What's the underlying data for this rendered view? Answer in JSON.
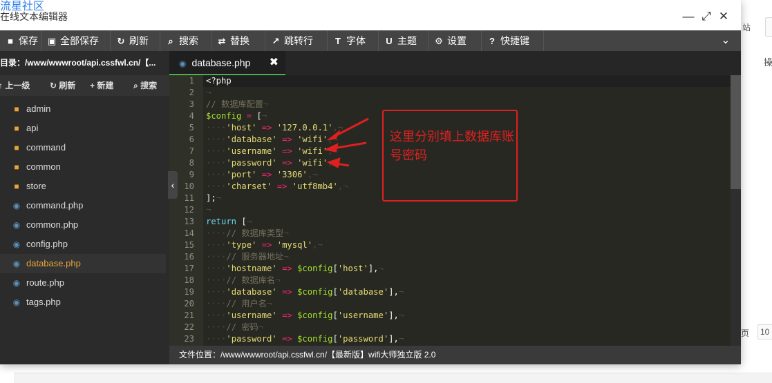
{
  "background": {
    "right_top_text": "站",
    "right_side_text": "操",
    "pager_text": "页",
    "pager_value": "10"
  },
  "window": {
    "brand": "流星社区",
    "title": "在线文本编辑器",
    "minimize_glyph": "—",
    "maximize_glyph": "⤢",
    "close_glyph": "✕"
  },
  "toolbar": {
    "items": [
      {
        "label": "保存",
        "icon": "save-icon"
      },
      {
        "label": "全部保存",
        "icon": "save-all-icon"
      },
      {
        "label": "刷新",
        "icon": "refresh-icon"
      },
      {
        "label": "搜索",
        "icon": "search-icon"
      },
      {
        "label": "替换",
        "icon": "replace-icon"
      },
      {
        "label": "跳转行",
        "icon": "goto-icon"
      },
      {
        "label": "字体",
        "icon": "font-icon"
      },
      {
        "label": "主题",
        "icon": "theme-icon"
      },
      {
        "label": "设置",
        "icon": "gear-icon"
      },
      {
        "label": "快捷键",
        "icon": "help-icon"
      }
    ]
  },
  "sidebar": {
    "path": "目录：/www/wwwroot/api.cssfwl.cn/【...",
    "actions": [
      {
        "label": "上一级",
        "icon": "up-icon"
      },
      {
        "label": "刷新",
        "icon": "refresh-icon"
      },
      {
        "label": "新建",
        "icon": "plus-icon"
      },
      {
        "label": "搜索",
        "icon": "search-icon"
      }
    ],
    "files": [
      {
        "name": "admin",
        "type": "folder"
      },
      {
        "name": "api",
        "type": "folder"
      },
      {
        "name": "command",
        "type": "folder"
      },
      {
        "name": "common",
        "type": "folder"
      },
      {
        "name": "store",
        "type": "folder"
      },
      {
        "name": "command.php",
        "type": "php"
      },
      {
        "name": "common.php",
        "type": "php"
      },
      {
        "name": "config.php",
        "type": "php"
      },
      {
        "name": "database.php",
        "type": "php",
        "active": true
      },
      {
        "name": "route.php",
        "type": "php"
      },
      {
        "name": "tags.php",
        "type": "php"
      }
    ]
  },
  "tab": {
    "label": "database.php",
    "close": "✖"
  },
  "code": {
    "lines": [
      [
        [
          "<?php",
          "pl"
        ]
      ],
      [
        [
          "¬",
          "ws"
        ]
      ],
      [
        [
          "// 数据库配置",
          "cm"
        ],
        [
          "¬",
          "ws"
        ]
      ],
      [
        [
          "$config",
          "vr"
        ],
        [
          " = ",
          "op"
        ],
        [
          "[",
          "pl"
        ],
        [
          "¬",
          "ws"
        ]
      ],
      [
        [
          "····",
          "ws"
        ],
        [
          "'host'",
          "st"
        ],
        [
          " => ",
          "op"
        ],
        [
          "'127.0.0.1'",
          "st"
        ],
        [
          ",¬",
          "ws"
        ]
      ],
      [
        [
          "····",
          "ws"
        ],
        [
          "'database'",
          "st"
        ],
        [
          " => ",
          "op"
        ],
        [
          "'wifi'",
          "st"
        ],
        [
          ",¬",
          "ws"
        ]
      ],
      [
        [
          "····",
          "ws"
        ],
        [
          "'username'",
          "st"
        ],
        [
          " => ",
          "op"
        ],
        [
          "'wifi'",
          "st"
        ],
        [
          ",¬",
          "ws"
        ]
      ],
      [
        [
          "····",
          "ws"
        ],
        [
          "'password'",
          "st"
        ],
        [
          " => ",
          "op"
        ],
        [
          "'wifi'",
          "st"
        ],
        [
          ",¬",
          "ws"
        ]
      ],
      [
        [
          "····",
          "ws"
        ],
        [
          "'port'",
          "st"
        ],
        [
          " => ",
          "op"
        ],
        [
          "'3306'",
          "st"
        ],
        [
          ",¬",
          "ws"
        ]
      ],
      [
        [
          "····",
          "ws"
        ],
        [
          "'charset'",
          "st"
        ],
        [
          " => ",
          "op"
        ],
        [
          "'utf8mb4'",
          "st"
        ],
        [
          ",¬",
          "ws"
        ]
      ],
      [
        [
          "];",
          "pl"
        ],
        [
          "¬",
          "ws"
        ]
      ],
      [
        [
          "¬",
          "ws"
        ]
      ],
      [
        [
          "return",
          "kw"
        ],
        [
          " [",
          "pl"
        ],
        [
          "¬",
          "ws"
        ]
      ],
      [
        [
          "····",
          "ws"
        ],
        [
          "// 数据库类型",
          "cm"
        ],
        [
          "¬",
          "ws"
        ]
      ],
      [
        [
          "····",
          "ws"
        ],
        [
          "'type'",
          "st"
        ],
        [
          " => ",
          "op"
        ],
        [
          "'mysql'",
          "st"
        ],
        [
          ",¬",
          "ws"
        ]
      ],
      [
        [
          "····",
          "ws"
        ],
        [
          "// 服务器地址",
          "cm"
        ],
        [
          "¬",
          "ws"
        ]
      ],
      [
        [
          "····",
          "ws"
        ],
        [
          "'hostname'",
          "st"
        ],
        [
          " => ",
          "op"
        ],
        [
          "$config",
          "vr"
        ],
        [
          "[",
          "pl"
        ],
        [
          "'host'",
          "st"
        ],
        [
          "],",
          "pl"
        ],
        [
          "¬",
          "ws"
        ]
      ],
      [
        [
          "····",
          "ws"
        ],
        [
          "// 数据库名",
          "cm"
        ],
        [
          "¬",
          "ws"
        ]
      ],
      [
        [
          "····",
          "ws"
        ],
        [
          "'database'",
          "st"
        ],
        [
          " => ",
          "op"
        ],
        [
          "$config",
          "vr"
        ],
        [
          "[",
          "pl"
        ],
        [
          "'database'",
          "st"
        ],
        [
          "],",
          "pl"
        ],
        [
          "¬",
          "ws"
        ]
      ],
      [
        [
          "····",
          "ws"
        ],
        [
          "// 用户名",
          "cm"
        ],
        [
          "¬",
          "ws"
        ]
      ],
      [
        [
          "····",
          "ws"
        ],
        [
          "'username'",
          "st"
        ],
        [
          " => ",
          "op"
        ],
        [
          "$config",
          "vr"
        ],
        [
          "[",
          "pl"
        ],
        [
          "'username'",
          "st"
        ],
        [
          "],",
          "pl"
        ],
        [
          "¬",
          "ws"
        ]
      ],
      [
        [
          "····",
          "ws"
        ],
        [
          "// 密码",
          "cm"
        ],
        [
          "¬",
          "ws"
        ]
      ],
      [
        [
          "····",
          "ws"
        ],
        [
          "'password'",
          "st"
        ],
        [
          " => ",
          "op"
        ],
        [
          "$config",
          "vr"
        ],
        [
          "[",
          "pl"
        ],
        [
          "'password'",
          "st"
        ],
        [
          "],",
          "pl"
        ],
        [
          "¬",
          "ws"
        ]
      ]
    ]
  },
  "status": {
    "text": "文件位置：/www/wwwroot/api.cssfwl.cn/【最新版】wifi大师独立版 2.0"
  },
  "annotation": {
    "text": "这里分别填上数据库账号密码",
    "color": "#e02020"
  },
  "colors": {
    "toolbar": "#444444",
    "sidebar": "#2b2b2b",
    "editor": "#272822",
    "accent": "#4caf50",
    "folder": "#e8a33d"
  }
}
